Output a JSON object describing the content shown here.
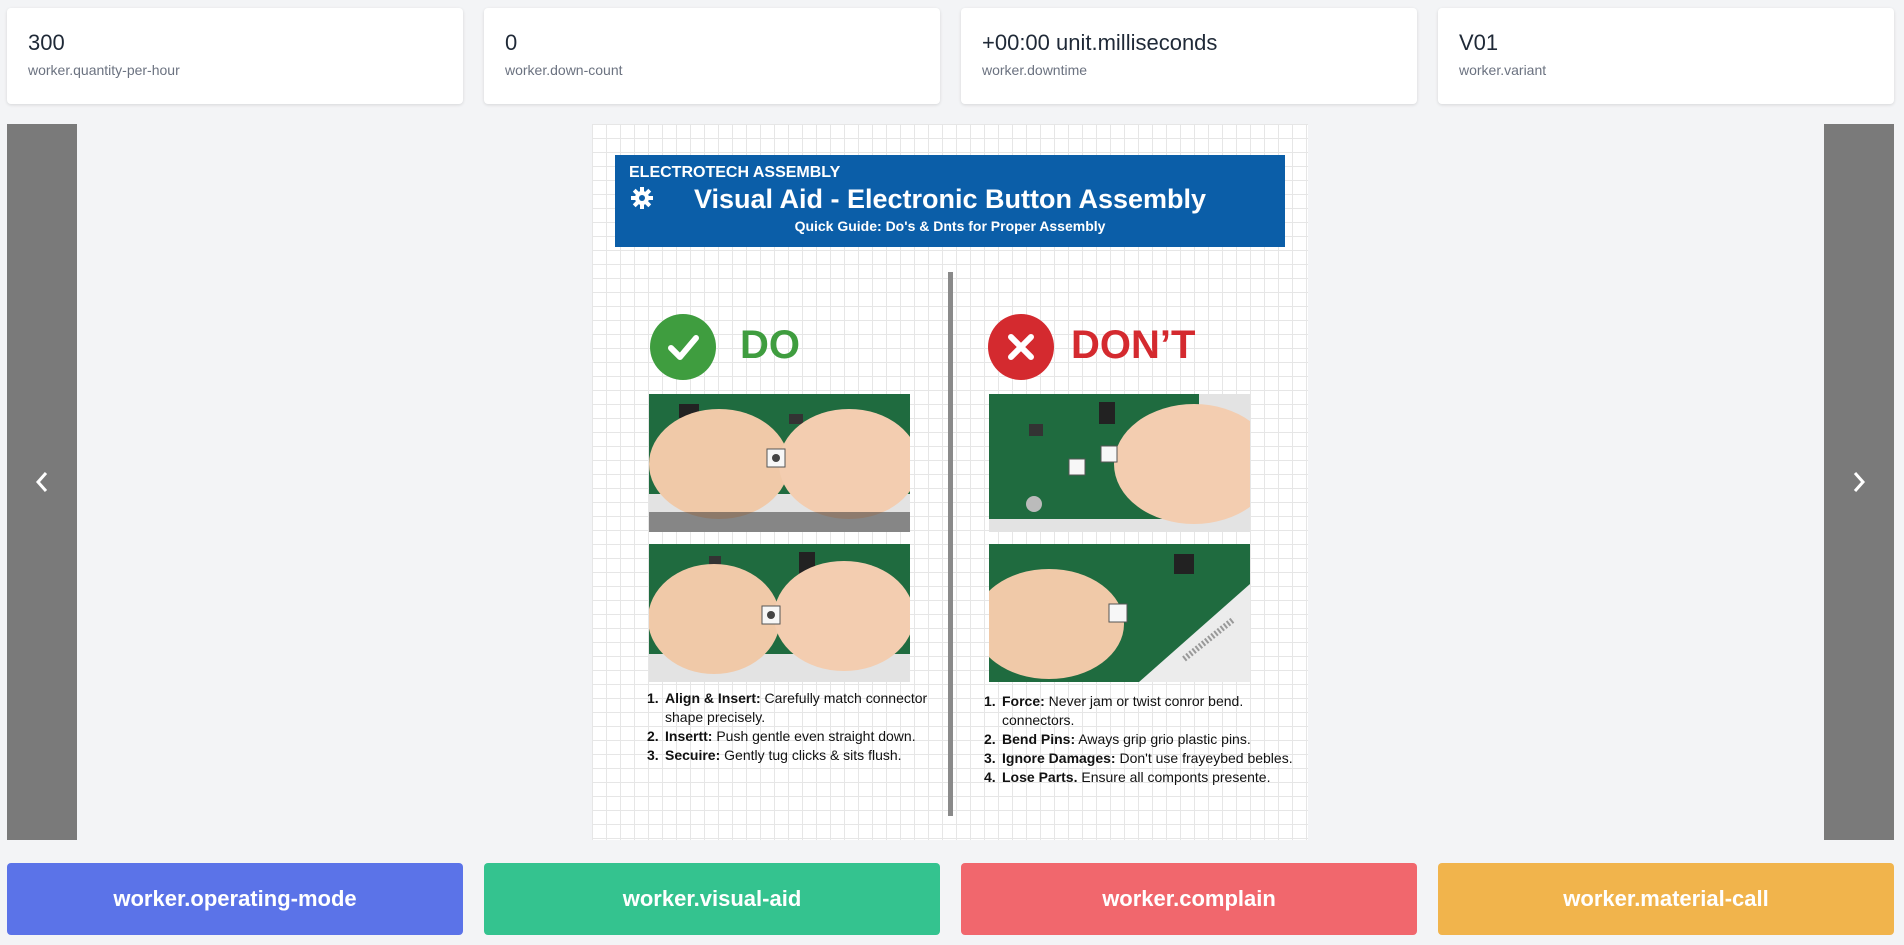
{
  "stats": [
    {
      "value": "300",
      "label": "worker.quantity-per-hour"
    },
    {
      "value": "0",
      "label": "worker.down-count"
    },
    {
      "value": "+00:00 unit.milliseconds",
      "label": "worker.downtime"
    },
    {
      "value": "V01",
      "label": "worker.variant"
    }
  ],
  "visual_aid": {
    "brand": "ELECTROTECH ASSEMBLY",
    "title": "Visual Aid - Electronic Button Assembly",
    "subtitle": "Quick Guide: Do's & Dnts for Proper Assembly",
    "do_heading": "DO",
    "dont_heading": "DON’T",
    "do_steps": [
      {
        "num": "1.",
        "term": "Align & Insert:",
        "text": " Carefully match connector shape precisely."
      },
      {
        "num": "2.",
        "term": "Insertt:",
        "text": " Push gentle even straight down."
      },
      {
        "num": "3.",
        "term": "Secuire:",
        "text": " Gently tug clicks & sits flush."
      }
    ],
    "dont_steps": [
      {
        "num": "1.",
        "term": "Force:",
        "text": " Never jam or twist conror bend. connectors."
      },
      {
        "num": "2.",
        "term": "Bend Pins:",
        "text": " Aways grip grio plastic pins."
      },
      {
        "num": "3.",
        "term": "Ignore Damages:",
        "text": "  Don't use frayeybed bebles."
      },
      {
        "num": "4.",
        "term": "Lose Parts.",
        "text": " Ensure all componts presente."
      }
    ],
    "colors": {
      "banner": "#0b5ea8",
      "do": "#3f9d3f",
      "dont": "#d42a2f"
    }
  },
  "nav": {
    "prev_icon": "chevron-left-icon",
    "next_icon": "chevron-right-icon"
  },
  "actions": [
    {
      "label": "worker.operating-mode",
      "color": "#5b73e8"
    },
    {
      "label": "worker.visual-aid",
      "color": "#34c38f"
    },
    {
      "label": "worker.complain",
      "color": "#f1676d"
    },
    {
      "label": "worker.material-call",
      "color": "#f1b44c"
    }
  ]
}
